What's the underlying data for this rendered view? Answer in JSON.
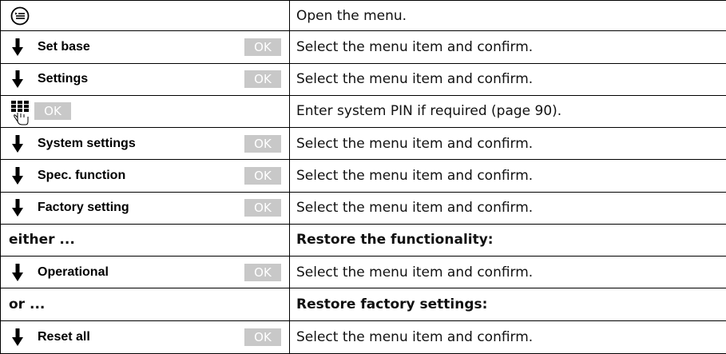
{
  "rows": [
    {
      "kind": "icon-menu",
      "icon": "menu-key-icon",
      "desc": "Open the menu."
    },
    {
      "kind": "item",
      "label": "Set base",
      "ok": "OK",
      "desc": "Select the menu item and confirm."
    },
    {
      "kind": "item",
      "label": "Settings",
      "ok": "OK",
      "desc": "Select the menu item and confirm."
    },
    {
      "kind": "pin",
      "icon": "keypad-icon",
      "ok": "OK",
      "desc": "Enter system PIN if required (page 90)."
    },
    {
      "kind": "item",
      "label": "System settings",
      "ok": "OK",
      "desc": "Select the menu item and confirm."
    },
    {
      "kind": "item",
      "label": "Spec. function",
      "ok": "OK",
      "desc": "Select the menu item and confirm."
    },
    {
      "kind": "item",
      "label": "Factory setting",
      "ok": "OK",
      "desc": "Select the menu item and confirm."
    },
    {
      "kind": "heading",
      "label": "either ...",
      "desc": "Restore the functionality:"
    },
    {
      "kind": "item",
      "label": "Operational",
      "ok": "OK",
      "desc": "Select the menu item and confirm."
    },
    {
      "kind": "heading",
      "label": "or ...",
      "desc": "Restore factory settings:"
    },
    {
      "kind": "item",
      "label": "Reset all",
      "ok": "OK",
      "desc": "Select the menu item and confirm."
    }
  ],
  "colors": {
    "border": "#000000",
    "ok_key_bg": "#c8c8c8",
    "ok_key_text": "#ffffff"
  },
  "icons": {
    "arrow": "down-arrow-icon",
    "menu": "menu-key-icon",
    "keypad": "keypad-icon"
  }
}
